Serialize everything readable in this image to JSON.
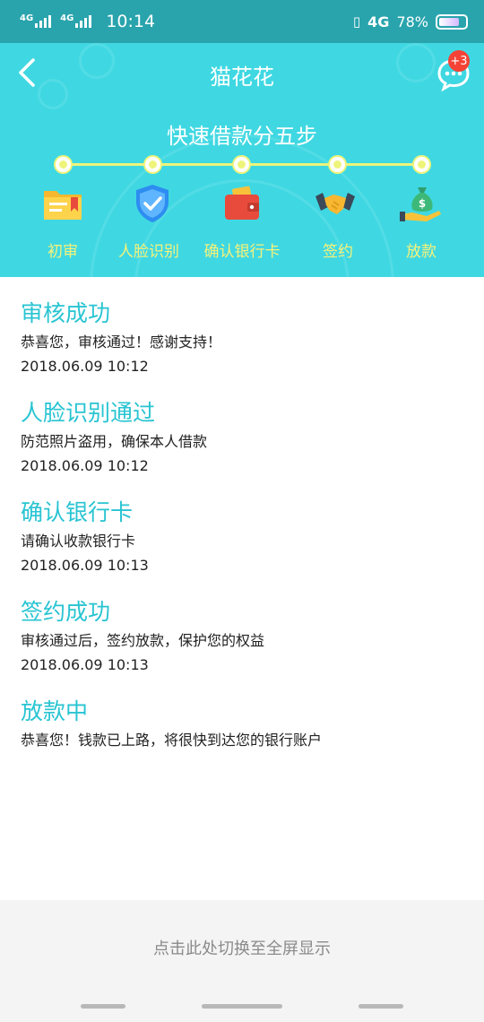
{
  "status_bar": {
    "sim1_label": "4G",
    "sim2_label": "4G",
    "time": "10:14",
    "network": "4G",
    "battery_percent": "78%",
    "battery_level": 0.78
  },
  "nav": {
    "title": "猫花花",
    "message_badge": "+3"
  },
  "steps": {
    "title": "快速借款分五步",
    "items": [
      {
        "label": "初审",
        "icon": "folder-icon"
      },
      {
        "label": "人脸识别",
        "icon": "shield-check-icon"
      },
      {
        "label": "确认银行卡",
        "icon": "wallet-icon"
      },
      {
        "label": "签约",
        "icon": "handshake-icon"
      },
      {
        "label": "放款",
        "icon": "money-bag-icon"
      }
    ]
  },
  "timeline": [
    {
      "title": "审核成功",
      "desc": "恭喜您，审核通过！感谢支持！",
      "time": "2018.06.09  10:12"
    },
    {
      "title": "人脸识别通过",
      "desc": "防范照片盗用，确保本人借款",
      "time": "2018.06.09  10:12"
    },
    {
      "title": "确认银行卡",
      "desc": "请确认收款银行卡",
      "time": "2018.06.09  10:13"
    },
    {
      "title": "签约成功",
      "desc": "审核通过后，签约放款，保护您的权益",
      "time": "2018.06.09  10:13"
    },
    {
      "title": "放款中",
      "desc": "恭喜您！钱款已上路，将很快到达您的银行账户",
      "time": ""
    }
  ],
  "footer": {
    "toggle_label": "点击此处切换至全屏显示"
  },
  "colors": {
    "header_bg": "#3fd8e2",
    "status_bg": "#29a4ad",
    "accent_title": "#29c4d2",
    "step_label": "#f6f27a",
    "badge": "#f44336"
  }
}
